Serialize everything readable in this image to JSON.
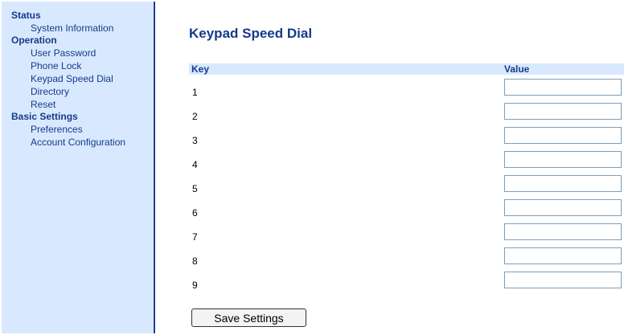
{
  "sidebar": {
    "sections": [
      {
        "title": "Status",
        "items": [
          "System Information"
        ]
      },
      {
        "title": "Operation",
        "items": [
          "User Password",
          "Phone Lock",
          "Keypad Speed Dial",
          "Directory",
          "Reset"
        ]
      },
      {
        "title": "Basic Settings",
        "items": [
          "Preferences",
          "Account Configuration"
        ]
      }
    ]
  },
  "main": {
    "title": "Keypad Speed Dial",
    "table": {
      "headers": {
        "key": "Key",
        "value": "Value"
      },
      "rows": [
        {
          "key": "1",
          "value": ""
        },
        {
          "key": "2",
          "value": ""
        },
        {
          "key": "3",
          "value": ""
        },
        {
          "key": "4",
          "value": ""
        },
        {
          "key": "5",
          "value": ""
        },
        {
          "key": "6",
          "value": ""
        },
        {
          "key": "7",
          "value": ""
        },
        {
          "key": "8",
          "value": ""
        },
        {
          "key": "9",
          "value": ""
        }
      ]
    },
    "save_label": "Save Settings"
  },
  "colors": {
    "sidebar_bg": "#d8e9ff",
    "accent": "#163a8a",
    "border": "#1d3f8b"
  }
}
